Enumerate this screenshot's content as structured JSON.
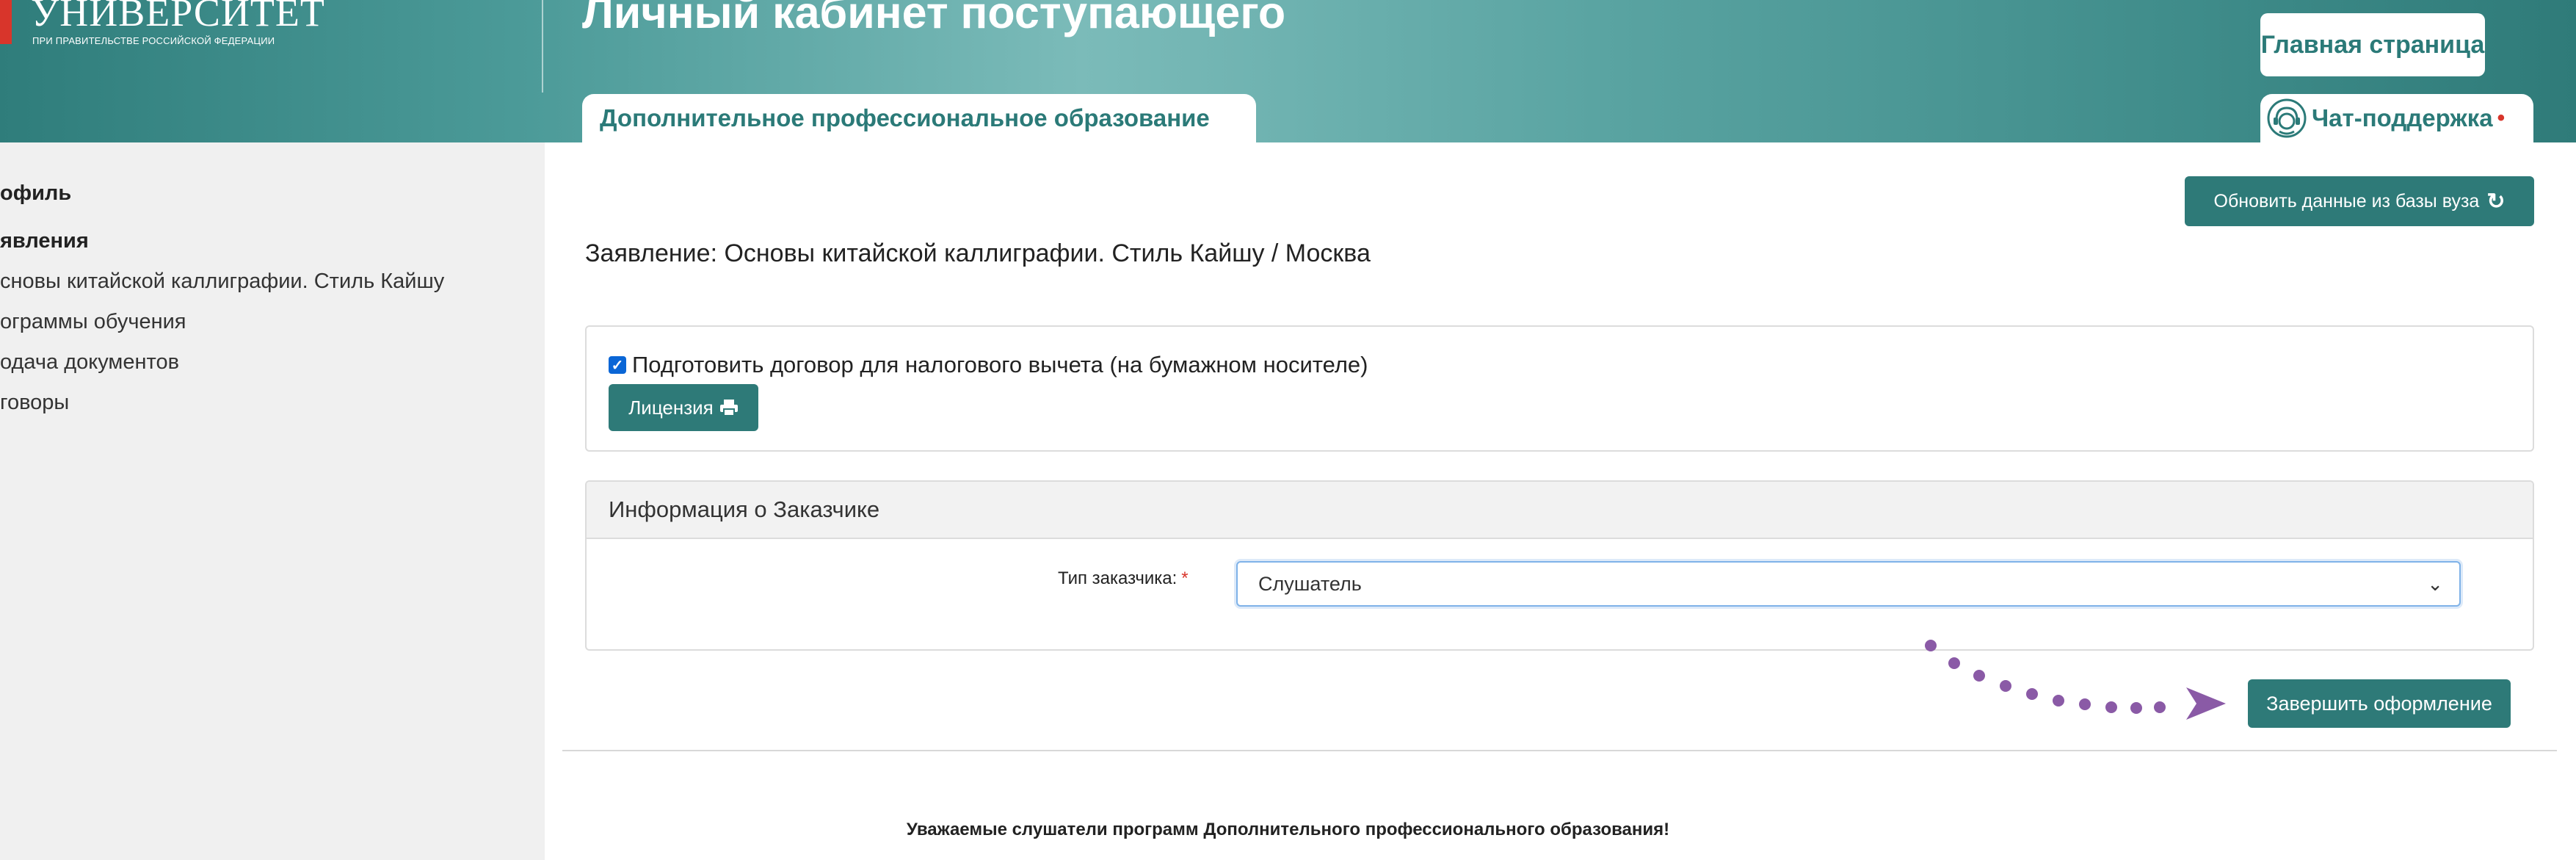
{
  "header": {
    "logo_title": "УНИВЕРСИТЕТ",
    "logo_subtitle": "ПРИ ПРАВИТЕЛЬСТВЕ РОССИЙСКОЙ ФЕДЕРАЦИИ",
    "page_title": "Личный кабинет поступающего",
    "home_button": "Главная страница",
    "active_tab": "Дополнительное профессиональное образование",
    "chat_tab": "Чат-поддержка",
    "chat_icon": "support-agent-icon",
    "accent_color": "#2e7a78",
    "logo_accent": "#d8352b"
  },
  "sidebar": {
    "items": [
      {
        "label": "офиль",
        "bold": true
      },
      {
        "label": "явления",
        "bold": true
      },
      {
        "label": "сновы китайской каллиграфии. Стиль Кайшу",
        "bold": false
      },
      {
        "label": "ограммы обучения",
        "bold": false
      },
      {
        "label": "одача документов",
        "bold": false
      },
      {
        "label": "говоры",
        "bold": false
      }
    ]
  },
  "main": {
    "refresh_button": "Обновить данные из базы вуза",
    "refresh_icon": "refresh-icon",
    "application_heading": "Заявление: Основы китайской каллиграфии. Стиль Кайшу / Москва",
    "tax_checkbox": {
      "label": "Подготовить договор для налогового вычета (на бумажном носителе)",
      "checked": true
    },
    "license_button": "Лицензия",
    "license_icon": "printer-icon",
    "customer_section": {
      "title": "Информация о Заказчике",
      "field_label": "Тип заказчика:",
      "required_mark": "*",
      "selected_value": "Слушатель"
    },
    "finish_button": "Завершить оформление",
    "notice": "Уважаемые слушатели программ Дополнительного профессионального образования!"
  }
}
